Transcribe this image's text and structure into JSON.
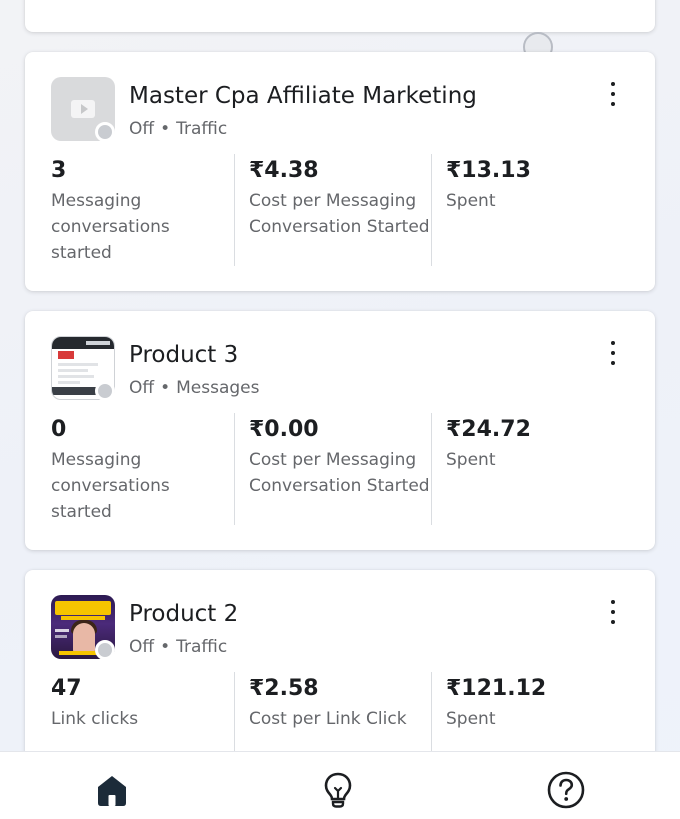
{
  "campaigns": [
    {
      "title": "Master Cpa Affiliate Marketing",
      "status": "Off",
      "objective": "Traffic",
      "thumbnail": "video-placeholder",
      "metrics": [
        {
          "value": "3",
          "label": "Messaging conversations started"
        },
        {
          "value": "₹4.38",
          "label": "Cost per Messaging Conversation Started"
        },
        {
          "value": "₹13.13",
          "label": "Spent"
        }
      ]
    },
    {
      "title": "Product 3",
      "status": "Off",
      "objective": "Messages",
      "thumbnail": "screenshot-image",
      "metrics": [
        {
          "value": "0",
          "label": "Messaging conversations started"
        },
        {
          "value": "₹0.00",
          "label": "Cost per Messaging Conversation Started"
        },
        {
          "value": "₹24.72",
          "label": "Spent"
        }
      ]
    },
    {
      "title": "Product 2",
      "status": "Off",
      "objective": "Traffic",
      "thumbnail": "dropshipping-poster-image",
      "metrics": [
        {
          "value": "47",
          "label": "Link clicks"
        },
        {
          "value": "₹2.58",
          "label": "Cost per Link Click"
        },
        {
          "value": "₹121.12",
          "label": "Spent"
        }
      ]
    }
  ],
  "separator": "•",
  "bottom_nav": {
    "items": [
      {
        "icon": "home-icon",
        "selected": true
      },
      {
        "icon": "lightbulb-icon",
        "selected": false
      },
      {
        "icon": "help-icon",
        "selected": false
      }
    ]
  },
  "colors": {
    "text_primary": "#1c1e21",
    "text_secondary": "#65676b",
    "status_off": "#c9ccd1",
    "divider": "#dadde1"
  }
}
